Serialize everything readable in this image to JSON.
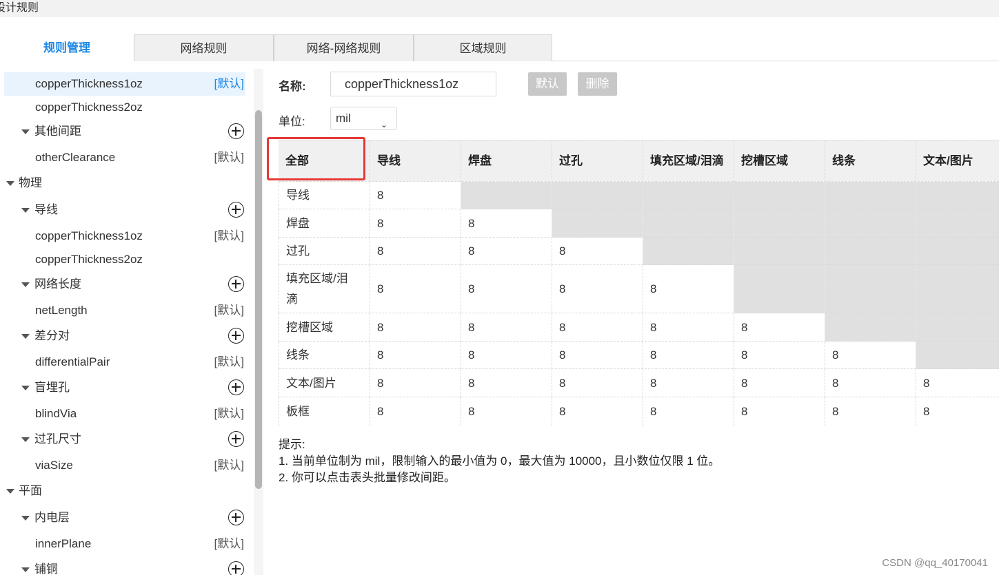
{
  "window": {
    "title": "设计规则"
  },
  "tabs": [
    {
      "label": "规则管理",
      "active": true
    },
    {
      "label": "网络规则",
      "active": false
    },
    {
      "label": "网络-网络规则",
      "active": false
    },
    {
      "label": "区域规则",
      "active": false
    }
  ],
  "tree": [
    {
      "label": "copperThickness1oz",
      "level": 2,
      "type": "leaf",
      "default_label": "[默认]",
      "selected": true
    },
    {
      "label": "copperThickness2oz",
      "level": 2,
      "type": "leaf",
      "default_label": ""
    },
    {
      "label": "其他间距",
      "level": 1,
      "type": "group",
      "add": true
    },
    {
      "label": "otherClearance",
      "level": 2,
      "type": "leaf",
      "default_label": "[默认]"
    },
    {
      "label": "物理",
      "level": 0,
      "type": "category"
    },
    {
      "label": "导线",
      "level": 1,
      "type": "group",
      "add": true
    },
    {
      "label": "copperThickness1oz",
      "level": 2,
      "type": "leaf",
      "default_label": "[默认]"
    },
    {
      "label": "copperThickness2oz",
      "level": 2,
      "type": "leaf",
      "default_label": ""
    },
    {
      "label": "网络长度",
      "level": 1,
      "type": "group",
      "add": true
    },
    {
      "label": "netLength",
      "level": 2,
      "type": "leaf",
      "default_label": "[默认]"
    },
    {
      "label": "差分对",
      "level": 1,
      "type": "group",
      "add": true
    },
    {
      "label": "differentialPair",
      "level": 2,
      "type": "leaf",
      "default_label": "[默认]"
    },
    {
      "label": "盲埋孔",
      "level": 1,
      "type": "group",
      "add": true
    },
    {
      "label": "blindVia",
      "level": 2,
      "type": "leaf",
      "default_label": "[默认]"
    },
    {
      "label": "过孔尺寸",
      "level": 1,
      "type": "group",
      "add": true
    },
    {
      "label": "viaSize",
      "level": 2,
      "type": "leaf",
      "default_label": "[默认]"
    },
    {
      "label": "平面",
      "level": 0,
      "type": "category"
    },
    {
      "label": "内电层",
      "level": 1,
      "type": "group",
      "add": true
    },
    {
      "label": "innerPlane",
      "level": 2,
      "type": "leaf",
      "default_label": "[默认]"
    },
    {
      "label": "铺铜",
      "level": 1,
      "type": "group",
      "add": true
    }
  ],
  "form": {
    "name_label": "名称:",
    "name_value": "copperThickness1oz",
    "default_button": "默认",
    "delete_button": "删除",
    "unit_label": "单位:",
    "unit_value": "mil"
  },
  "matrix": {
    "corner": "全部",
    "columns": [
      "导线",
      "焊盘",
      "过孔",
      "填充区域/泪滴",
      "挖槽区域",
      "线条",
      "文本/图片"
    ],
    "rows": [
      {
        "label": "导线",
        "values": [
          "8"
        ]
      },
      {
        "label": "焊盘",
        "values": [
          "8",
          "8"
        ]
      },
      {
        "label": "过孔",
        "values": [
          "8",
          "8",
          "8"
        ]
      },
      {
        "label": "填充区域/泪滴",
        "values": [
          "8",
          "8",
          "8",
          "8"
        ]
      },
      {
        "label": "挖槽区域",
        "values": [
          "8",
          "8",
          "8",
          "8",
          "8"
        ]
      },
      {
        "label": "线条",
        "values": [
          "8",
          "8",
          "8",
          "8",
          "8",
          "8"
        ]
      },
      {
        "label": "文本/图片",
        "values": [
          "8",
          "8",
          "8",
          "8",
          "8",
          "8",
          "8"
        ]
      },
      {
        "label": "板框",
        "values": [
          "8",
          "8",
          "8",
          "8",
          "8",
          "8",
          "8"
        ]
      }
    ]
  },
  "hint": {
    "title": "提示:",
    "lines": [
      "1. 当前单位制为 mil，限制输入的最小值为 0，最大值为 10000，且小数位仅限 1 位。",
      "2. 你可以点击表头批量修改间距。"
    ]
  },
  "watermark": "CSDN @qq_40170041"
}
